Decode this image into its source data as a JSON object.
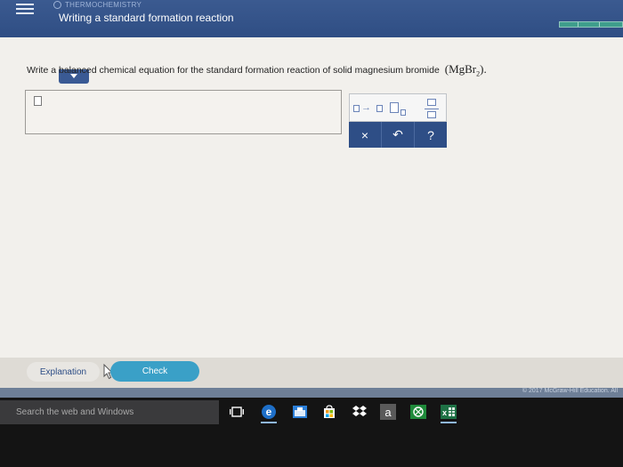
{
  "header": {
    "topic_label": "THERMOCHEMISTRY",
    "title": "Writing a standard formation reaction",
    "progress_fraction": 1.0
  },
  "question": {
    "text": "Write a balanced chemical equation for the standard formation reaction of solid magnesium bromide",
    "formula_open": "(",
    "formula_main": "MgBr",
    "formula_subscript": "2",
    "formula_close": ")."
  },
  "answer": {
    "value": ""
  },
  "palette": {
    "reaction_arrow": "→",
    "clear_symbol": "×",
    "undo_symbol": "↶",
    "help_symbol": "?"
  },
  "actions": {
    "explanation_label": "Explanation",
    "check_label": "Check"
  },
  "footer": {
    "copyright": "© 2017 McGraw-Hill Education. All"
  },
  "taskbar": {
    "search_placeholder": "Search the web and Windows",
    "amazon_glyph": "a",
    "excel_glyph": "x"
  },
  "colors": {
    "header_blue": "#2f4e84",
    "palette_blue": "#2e4e86",
    "check_blue": "#3aa0c7",
    "progress_green": "#3f9e8c",
    "edge_blue": "#1e6fc8",
    "store_orange": "#f09a1e",
    "maps_blue": "#2c7fd8",
    "dropbox_blue": "#2f8fe8",
    "xbox_green": "#1f8a3a",
    "excel_green": "#1e7145"
  },
  "icons": {
    "menu": "hamburger-menu-icon",
    "task_view": "task-view-icon",
    "edge": "edge-browser-icon",
    "store": "store-icon",
    "maps": "maps-icon",
    "dropbox": "dropbox-icon",
    "amazon": "amazon-icon",
    "xbox": "xbox-icon",
    "excel": "excel-icon"
  }
}
